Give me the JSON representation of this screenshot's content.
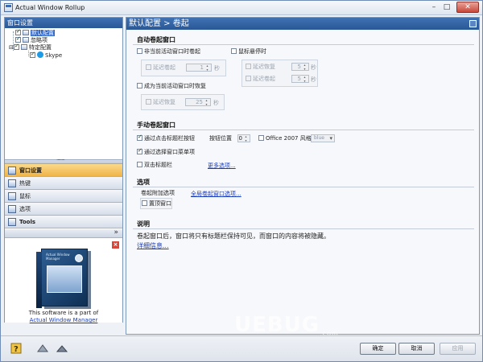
{
  "window": {
    "title": "Actual Window Rollup",
    "min": "–",
    "max": "□",
    "close": "✕"
  },
  "left": {
    "header": "窗口设置",
    "tree": [
      {
        "label": "默认配置",
        "checked": true,
        "selected": true
      },
      {
        "label": "忽略项",
        "checked": true
      },
      {
        "label": "特定配置",
        "checked": true
      },
      {
        "label": "Skype",
        "checked": true
      }
    ],
    "nav": [
      {
        "label": "窗口设置"
      },
      {
        "label": "热键"
      },
      {
        "label": "鼠标"
      },
      {
        "label": "选项"
      },
      {
        "label": "Tools"
      }
    ],
    "nav_more": "»",
    "promo": {
      "line1": "This software is a part of",
      "link": "Actual Window Manager",
      "close": "×",
      "box_brand": "Actual Window Manager"
    }
  },
  "right": {
    "header": "默认配置 > 卷起",
    "auto": {
      "title": "自动卷起窗口",
      "inactive_label": "非当前活动窗口时卷起",
      "delay_rollup": "延迟卷起",
      "delay_value_1": "1",
      "unit_sec": "秒",
      "hover_label": "鼠标悬停时",
      "delay_restore": "延迟恢复",
      "hover_restore_value": "5",
      "hover_rollup_value": "5",
      "active_label": "成为当前活动窗口时恢复",
      "active_restore_value": "25"
    },
    "manual": {
      "title": "手动卷起窗口",
      "click_title_btn": "通过点击标题栏按钮",
      "btn_pos_label": "按钮位置",
      "btn_pos_value": "0",
      "office_style": "Office 2007 风格",
      "style_select": "blue",
      "menu_item": "通过选择窗口菜单项",
      "dblclick": "双击标题栏",
      "more_options": "更多选项..."
    },
    "options": {
      "title": "选项",
      "extra_label": "卷起附加选项",
      "global_link": "全局卷起窗口选项...",
      "topmost": "置顶窗口"
    },
    "desc": {
      "title": "说明",
      "text": "卷起窗口后，窗口将只有标题栏保持可见，而窗口的内容将被隐藏。",
      "more": "详细信息..."
    }
  },
  "buttons": {
    "ok": "确定",
    "cancel": "取消",
    "apply": "应用"
  },
  "watermark": {
    "main": "UEBUG",
    "sub": ".com"
  }
}
